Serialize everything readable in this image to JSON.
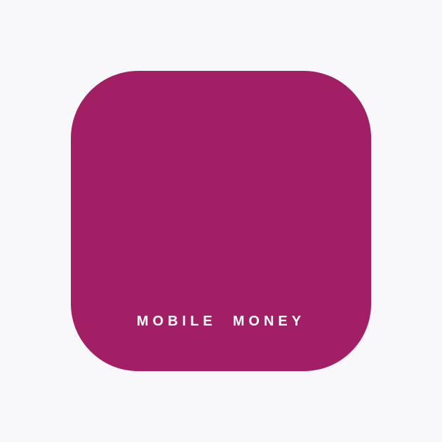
{
  "app_icon": {
    "label": "MOBILE  MONEY",
    "background_color": "#a31f65",
    "text_color": "#ffffff"
  },
  "page": {
    "background_color": "#f8f8fa"
  }
}
